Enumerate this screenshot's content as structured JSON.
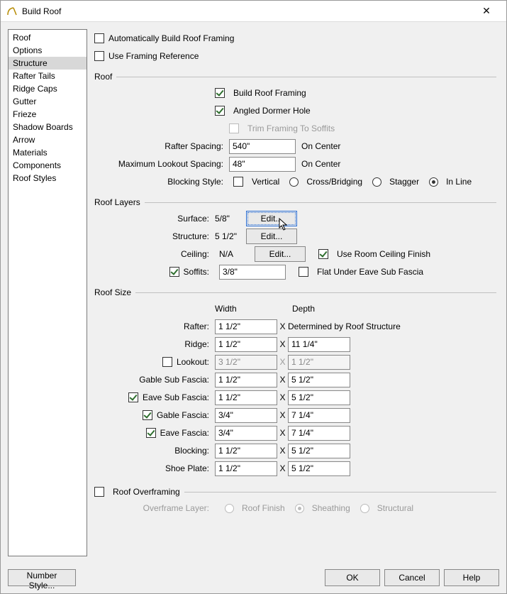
{
  "window": {
    "title": "Build Roof"
  },
  "sidebar": {
    "items": [
      "Roof",
      "Options",
      "Structure",
      "Rafter Tails",
      "Ridge Caps",
      "Gutter",
      "Frieze",
      "Shadow Boards",
      "Arrow",
      "Materials",
      "Components",
      "Roof Styles"
    ],
    "selected_index": 2
  },
  "top": {
    "auto_build": "Automatically Build Roof Framing",
    "use_framing_ref": "Use Framing Reference"
  },
  "roof": {
    "heading": "Roof",
    "build_roof_framing": "Build Roof Framing",
    "angled_dormer_hole": "Angled Dormer Hole",
    "trim_to_soffits": "Trim Framing To Soffits",
    "rafter_spacing_label": "Rafter Spacing:",
    "rafter_spacing_value": "540\"",
    "on_center": "On Center",
    "max_lookout_label": "Maximum Lookout Spacing:",
    "max_lookout_value": "48\"",
    "blocking_label": "Blocking Style:",
    "blocking_vertical": "Vertical",
    "blocking_cross": "Cross/Bridging",
    "blocking_stagger": "Stagger",
    "blocking_inline": "In Line"
  },
  "layers": {
    "heading": "Roof Layers",
    "surface_label": "Surface:",
    "surface_value": "5/8\"",
    "structure_label": "Structure:",
    "structure_value": "5 1/2\"",
    "ceiling_label": "Ceiling:",
    "ceiling_value": "N/A",
    "edit": "Edit...",
    "use_room_ceiling": "Use Room Ceiling Finish",
    "soffits_label": "Soffits:",
    "soffits_value": "3/8\"",
    "flat_under": "Flat Under Eave Sub Fascia"
  },
  "size": {
    "heading": "Roof Size",
    "width_h": "Width",
    "depth_h": "Depth",
    "rows": {
      "rafter": {
        "label": "Rafter:",
        "w": "1 1/2\"",
        "depth_text": "Determined by Roof Structure"
      },
      "ridge": {
        "label": "Ridge:",
        "w": "1 1/2\"",
        "d": "11 1/4\""
      },
      "lookout": {
        "label": "Lookout:",
        "w": "3 1/2\"",
        "d": "1 1/2\""
      },
      "gable_sub": {
        "label": "Gable Sub Fascia:",
        "w": "1 1/2\"",
        "d": "5 1/2\""
      },
      "eave_sub": {
        "label": "Eave Sub Fascia:",
        "w": "1 1/2\"",
        "d": "5 1/2\""
      },
      "gable_f": {
        "label": "Gable Fascia:",
        "w": "3/4\"",
        "d": "7 1/4\""
      },
      "eave_f": {
        "label": "Eave Fascia:",
        "w": "3/4\"",
        "d": "7 1/4\""
      },
      "blocking": {
        "label": "Blocking:",
        "w": "1 1/2\"",
        "d": "5 1/2\""
      },
      "shoe": {
        "label": "Shoe Plate:",
        "w": "1 1/2\"",
        "d": "5 1/2\""
      }
    }
  },
  "overframe": {
    "heading": "Roof Overframing",
    "layer_label": "Overframe Layer:",
    "roof_finish": "Roof Finish",
    "sheathing": "Sheathing",
    "structural": "Structural"
  },
  "footer": {
    "number_style": "Number Style...",
    "ok": "OK",
    "cancel": "Cancel",
    "help": "Help"
  }
}
